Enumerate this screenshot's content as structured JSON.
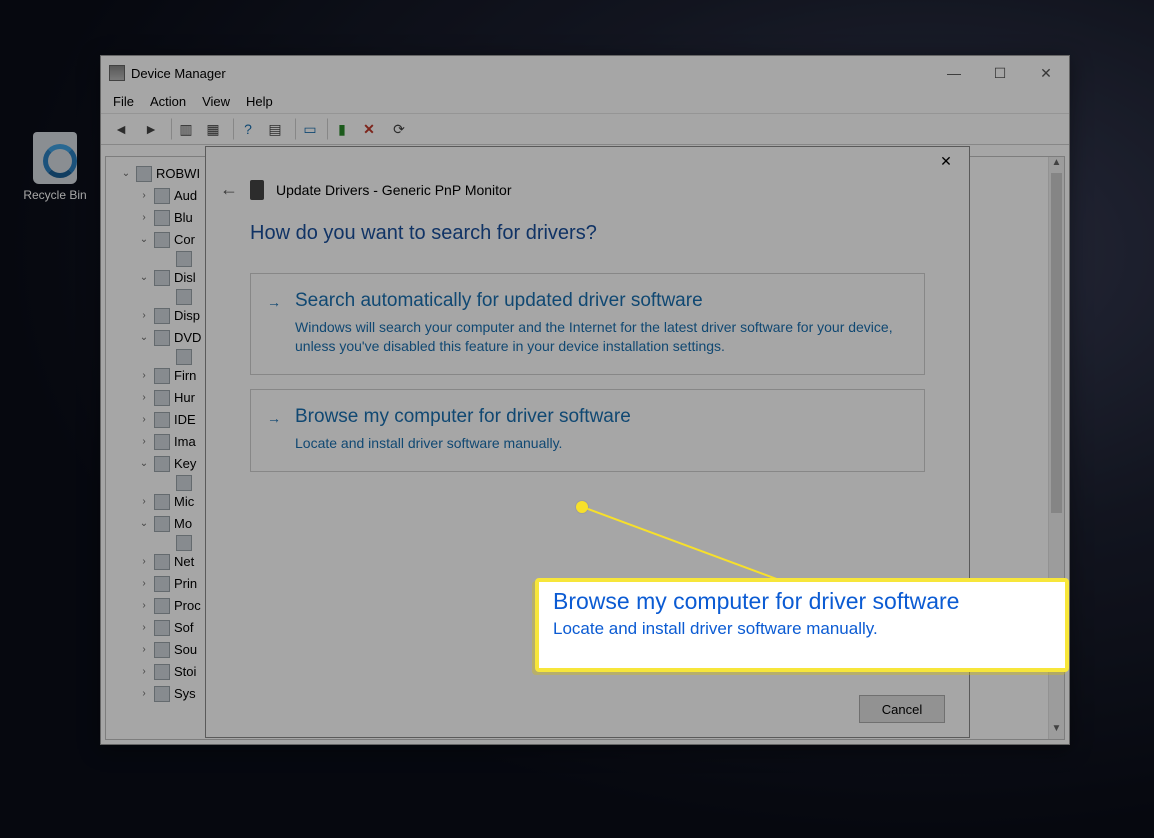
{
  "desktop": {
    "recycle_bin": "Recycle Bin"
  },
  "devmgr": {
    "title": "Device Manager",
    "menu": {
      "file": "File",
      "action": "Action",
      "view": "View",
      "help": "Help"
    },
    "tree": {
      "root": "ROBWI",
      "items": [
        {
          "label": "Aud",
          "depth": 2,
          "twist": ">"
        },
        {
          "label": "Blu",
          "depth": 2,
          "twist": ">"
        },
        {
          "label": "Cor",
          "depth": 2,
          "twist": "v",
          "children": [
            {
              "label": ""
            }
          ]
        },
        {
          "label": "Disl",
          "depth": 2,
          "twist": "v",
          "children": [
            {
              "label": ""
            }
          ]
        },
        {
          "label": "Disp",
          "depth": 2,
          "twist": ">"
        },
        {
          "label": "DVD",
          "depth": 2,
          "twist": "v",
          "children": [
            {
              "label": ""
            }
          ]
        },
        {
          "label": "Firn",
          "depth": 2,
          "twist": ">"
        },
        {
          "label": "Hur",
          "depth": 2,
          "twist": ">"
        },
        {
          "label": "IDE",
          "depth": 2,
          "twist": ">"
        },
        {
          "label": "Ima",
          "depth": 2,
          "twist": ">"
        },
        {
          "label": "Key",
          "depth": 2,
          "twist": "v",
          "children": [
            {
              "label": ""
            }
          ]
        },
        {
          "label": "Mic",
          "depth": 2,
          "twist": ">"
        },
        {
          "label": "Mo",
          "depth": 2,
          "twist": "v",
          "children": [
            {
              "label": ""
            }
          ]
        },
        {
          "label": "Net",
          "depth": 2,
          "twist": ">"
        },
        {
          "label": "Prin",
          "depth": 2,
          "twist": ">"
        },
        {
          "label": "Proc",
          "depth": 2,
          "twist": ">"
        },
        {
          "label": "Sof",
          "depth": 2,
          "twist": ">"
        },
        {
          "label": "Sou",
          "depth": 2,
          "twist": ">"
        },
        {
          "label": "Stoi",
          "depth": 2,
          "twist": ">"
        },
        {
          "label": "Sys",
          "depth": 2,
          "twist": ">"
        }
      ]
    }
  },
  "dialog": {
    "title": "Update Drivers - Generic PnP Monitor",
    "question": "How do you want to search for drivers?",
    "option1": {
      "title": "Search automatically for updated driver software",
      "desc": "Windows will search your computer and the Internet for the latest driver software for your device, unless you've disabled this feature in your device installation settings."
    },
    "option2": {
      "title": "Browse my computer for driver software",
      "desc": "Locate and install driver software manually."
    },
    "cancel": "Cancel"
  },
  "callout": {
    "title": "Browse my computer for driver software",
    "desc": "Locate and install driver software manually."
  }
}
